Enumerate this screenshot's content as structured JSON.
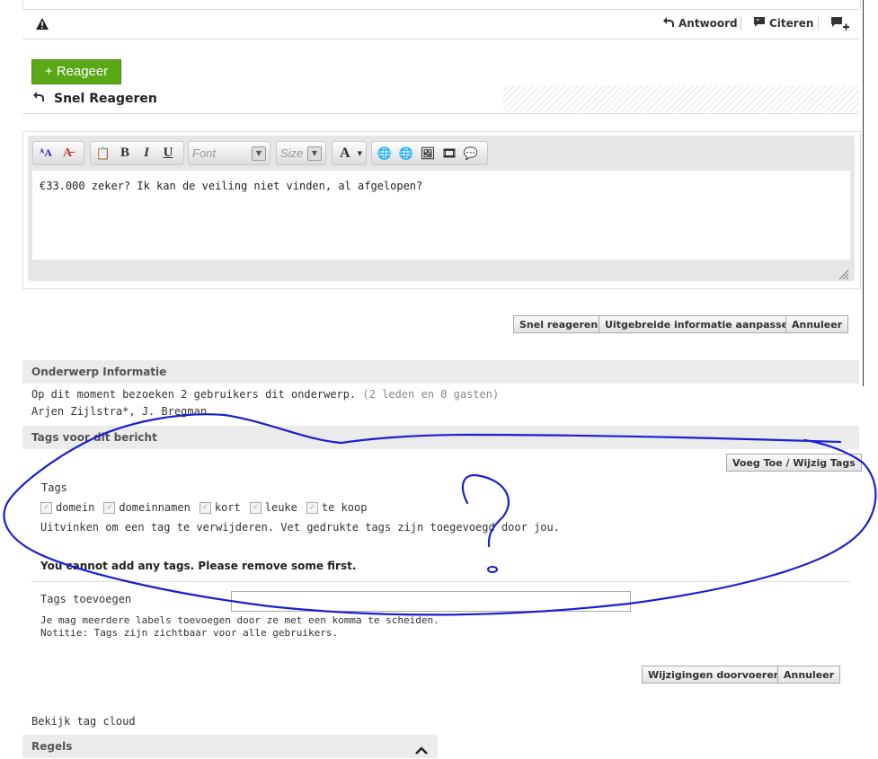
{
  "post_toolbar": {
    "reply_label": "Antwoord",
    "quote_label": "Citeren"
  },
  "quick_reply": {
    "button_label": "+ Reageer",
    "title": "Snel Reageren",
    "editor": {
      "font_placeholder": "Font",
      "size_placeholder": "Size",
      "content": "€33.000 zeker? Ik kan de veiling niet vinden, al afgelopen?"
    },
    "buttons": {
      "snel": "Snel reageren",
      "uitgebreid": "Uitgebreide informatie aanpassen",
      "annuleer": "Annuleer"
    }
  },
  "topic_info": {
    "header": "Onderwerp Informatie",
    "visitors_text": "Op dit moment bezoeken 2 gebruikers dit onderwerp.",
    "visitors_detail": "(2 leden en 0 gasten)",
    "users": "Arjen Zijlstra*, J. Bregman"
  },
  "tags_section": {
    "header": "Tags voor dit bericht",
    "edit_button": "Voeg Toe / Wijzig Tags",
    "tags_label": "Tags",
    "tags": [
      "domein",
      "domeinnamen",
      "kort",
      "leuke",
      "te koop"
    ],
    "uncheck_hint": "Uitvinken om een tag te verwijderen. Vet gedrukte tags zijn toegevoegd door jou.",
    "cannot_add": "You cannot add any tags. Please remove some first.",
    "add_label": "Tags toevoegen",
    "add_hint_1": "Je mag meerdere labels toevoegen door ze met een komma te scheiden.",
    "add_hint_2": "Notitie: Tags zijn zichtbaar voor alle gebruikers.",
    "submit_button": "Wijzigingen doorvoeren",
    "cancel_button": "Annuleer"
  },
  "footer": {
    "tag_cloud_link": "Bekijk tag cloud",
    "rules_header": "Regels"
  },
  "colors": {
    "accent_green": "#5aa816",
    "annotation_blue": "#1a1fd0"
  }
}
